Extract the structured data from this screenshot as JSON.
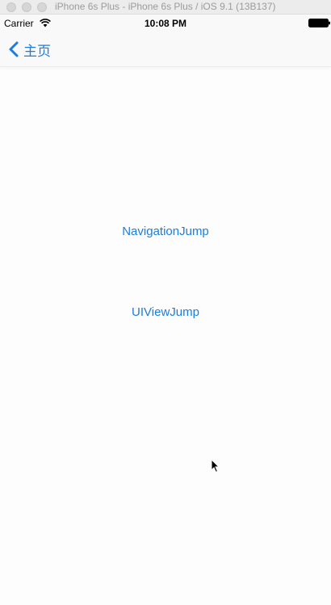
{
  "titlebar": {
    "text": "iPhone 6s Plus - iPhone 6s Plus / iOS 9.1 (13B137)"
  },
  "statusbar": {
    "carrier": "Carrier",
    "time": "10:08 PM",
    "icons": [
      "wifi-icon",
      "battery-icon"
    ]
  },
  "navbar": {
    "back_label": "主页",
    "back_icon": "chevron-left-icon"
  },
  "main": {
    "buttons": [
      {
        "label": "NavigationJump"
      },
      {
        "label": "UIViewJump"
      }
    ]
  },
  "colors": {
    "accent": "#1a7ee0",
    "background": "#fdfdfd"
  }
}
